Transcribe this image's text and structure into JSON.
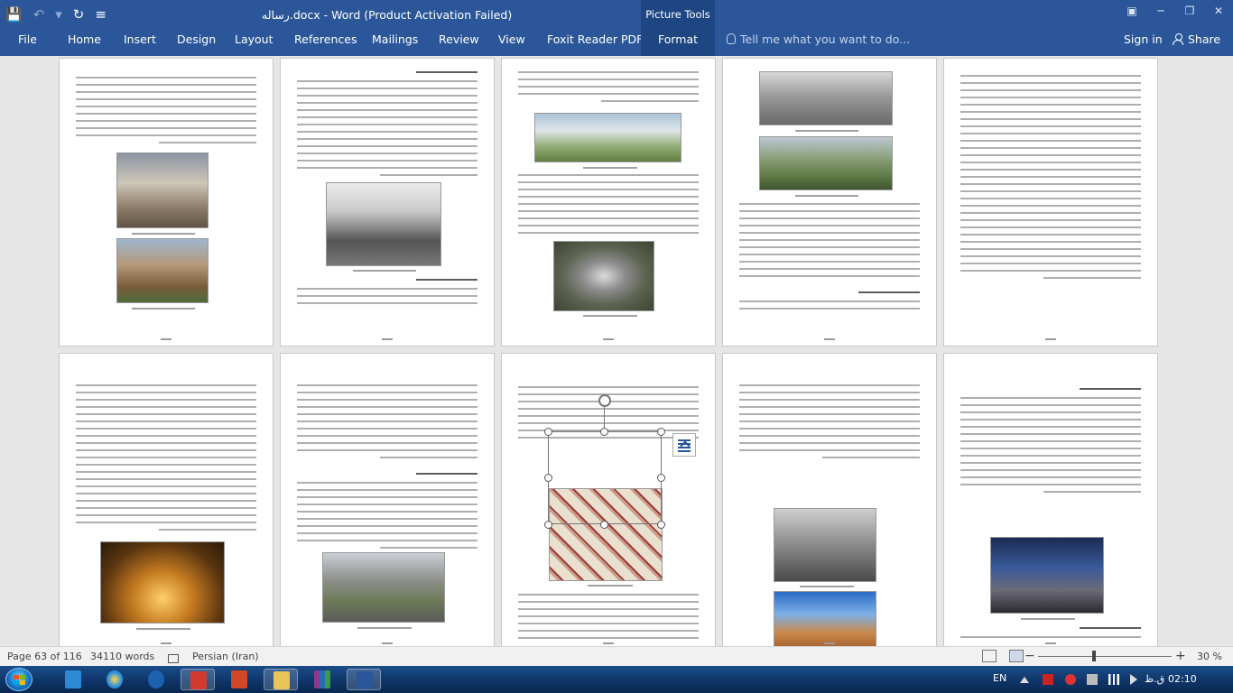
{
  "titlebar": {
    "title": "رساله.docx - Word (Product Activation Failed)",
    "contextual_group": "Picture Tools"
  },
  "ribbon": {
    "tabs": [
      {
        "label": "File"
      },
      {
        "label": "Home"
      },
      {
        "label": "Insert"
      },
      {
        "label": "Design"
      },
      {
        "label": "Layout"
      },
      {
        "label": "References"
      },
      {
        "label": "Mailings"
      },
      {
        "label": "Review"
      },
      {
        "label": "View"
      },
      {
        "label": "Foxit Reader PDF"
      }
    ],
    "format_tab": "Format",
    "tell_me_placeholder": "Tell me what you want to do...",
    "sign_in": "Sign in",
    "share": "Share"
  },
  "statusbar": {
    "page": "Page 63 of 116",
    "words": "34110 words",
    "language": "Persian (Iran)",
    "zoom": "30 %",
    "zoom_minus": "−",
    "zoom_plus": "+"
  },
  "taskbar": {
    "language": "EN",
    "time": "02:10",
    "ampm": "ق.ظ",
    "apps": [
      "explorer-app",
      "internet-explorer-app",
      "media-player-app",
      "acrobat-app",
      "powerpoint-app",
      "folder-app",
      "winrar-app",
      "word-app"
    ]
  },
  "colors": {
    "ribbon_blue": "#2b579a",
    "contextual_blue": "#1e4682",
    "taskbar": "#0e3366"
  }
}
